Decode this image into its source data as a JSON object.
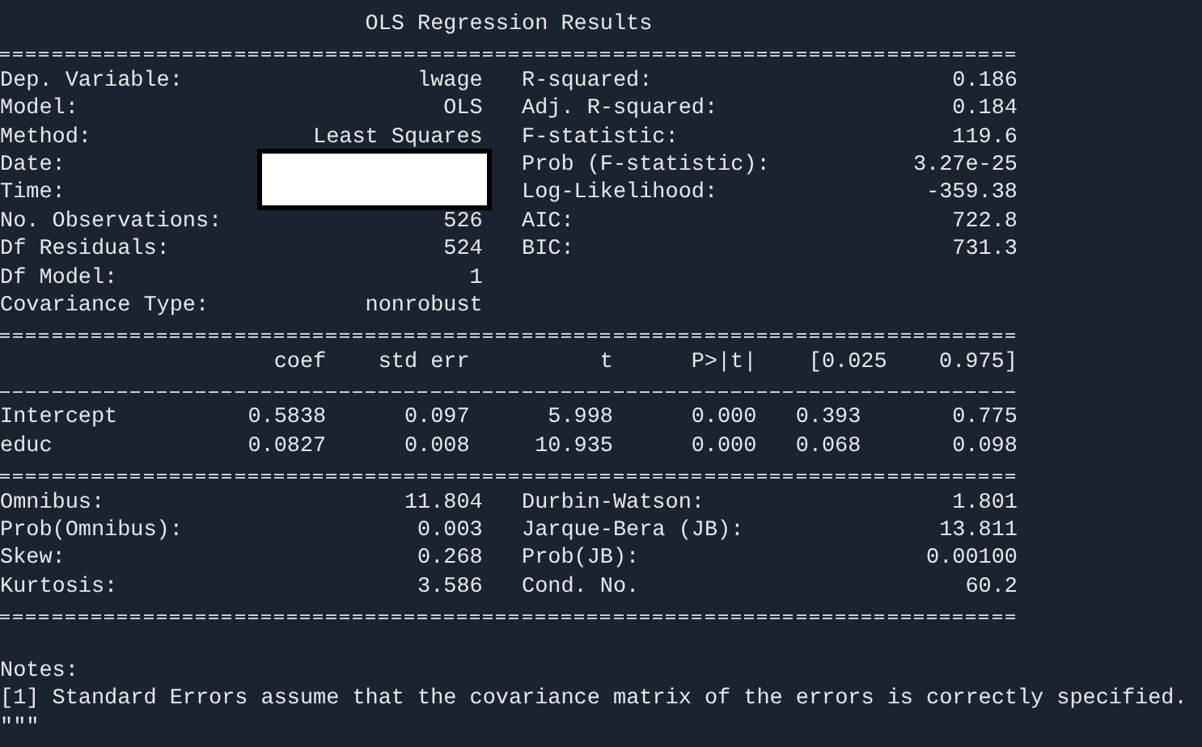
{
  "title": "OLS Regression Results",
  "model_info": [
    {
      "label": "Dep. Variable:",
      "value": "lwage",
      "label_2": "R-squared:",
      "value_2": "0.186"
    },
    {
      "label": "Model:",
      "value": "OLS",
      "label_2": "Adj. R-squared:",
      "value_2": "0.184"
    },
    {
      "label": "Method:",
      "value": "Least Squares",
      "label_2": "F-statistic:",
      "value_2": "119.6"
    },
    {
      "label": "Date:",
      "redacted": true,
      "label_2": "Prob (F-statistic):",
      "value_2": "3.27e-25"
    },
    {
      "label": "Time:",
      "redacted": true,
      "label_2": "Log-Likelihood:",
      "value_2": "-359.38"
    },
    {
      "label": "No. Observations:",
      "value": "526",
      "label_2": "AIC:",
      "value_2": "722.8"
    },
    {
      "label": "Df Residuals:",
      "value": "524",
      "label_2": "BIC:",
      "value_2": "731.3"
    },
    {
      "label": "Df Model:",
      "value": "1"
    },
    {
      "label": "Covariance Type:",
      "value": "nonrobust"
    }
  ],
  "coefficients": {
    "columns": [
      "coef",
      "std err",
      "t",
      "P>|t|",
      "[0.025",
      "0.975]"
    ],
    "rows": [
      {
        "name": "Intercept",
        "values": [
          "0.5838",
          "0.097",
          "5.998",
          "0.000",
          "0.393",
          "0.775"
        ]
      },
      {
        "name": "educ",
        "values": [
          "0.0827",
          "0.008",
          "10.935",
          "0.000",
          "0.068",
          "0.098"
        ]
      }
    ]
  },
  "diagnostics": [
    {
      "label": "Omnibus:",
      "value": "11.804",
      "label_2": "Durbin-Watson:",
      "value_2": "1.801"
    },
    {
      "label": "Prob(Omnibus):",
      "value": "0.003",
      "label_2": "Jarque-Bera (JB):",
      "value_2": "13.811"
    },
    {
      "label": "Skew:",
      "value": "0.268",
      "label_2": "Prob(JB):",
      "value_2": "0.00100"
    },
    {
      "label": "Kurtosis:",
      "value": "3.586",
      "label_2": "Cond. No.",
      "value_2": "60.2"
    }
  ],
  "notes": {
    "heading": "Notes:",
    "items": [
      "[1] Standard Errors assume that the covariance matrix of the errors is correctly specified."
    ]
  },
  "closing": "\"\"\""
}
